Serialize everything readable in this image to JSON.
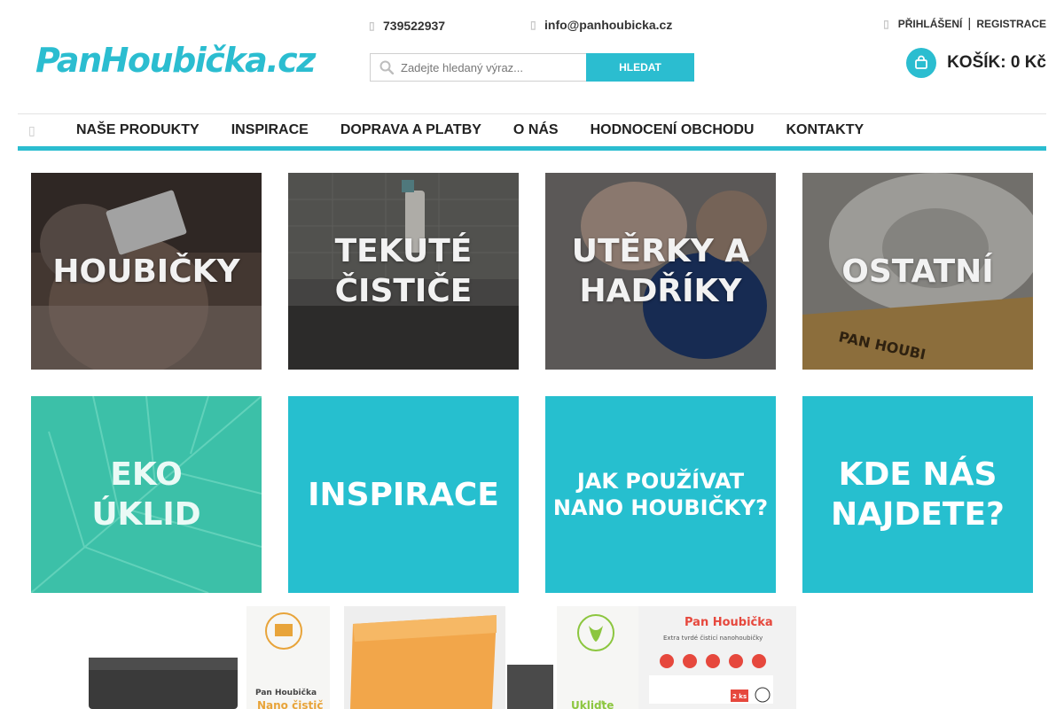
{
  "header": {
    "logo_text": "PanHoubička.cz",
    "phone": "739522937",
    "email": "info@panhoubicka.cz",
    "search_placeholder": "Zadejte hledaný výraz...",
    "search_button": "HLEDAT",
    "login": "PŘIHLÁŠENÍ",
    "separator": "|",
    "register": "REGISTRACE",
    "cart_label": "KOŠÍK:",
    "cart_total": "0 Kč"
  },
  "nav": {
    "items": [
      "NAŠE PRODUKTY",
      "INSPIRACE",
      "DOPRAVA A PLATBY",
      "O NÁS",
      "HODNOCENÍ OBCHODU",
      "KONTAKTY"
    ]
  },
  "tiles": [
    {
      "label": "HOUBIČKY"
    },
    {
      "label": "TEKUTÉ\nČISTIČE"
    },
    {
      "label": "UTĚRKY A\nHADŘÍKY"
    },
    {
      "label": "OSTATNÍ"
    },
    {
      "label": "EKO\nÚKLID"
    },
    {
      "label": "INSPIRACE"
    },
    {
      "label": "JAK POUŽÍVAT\nNANO HOUBIČKY?"
    },
    {
      "label": "KDE NÁS\nNAJDETE?"
    }
  ],
  "products": {
    "bottle1_text": "Nano čistič",
    "bottle2_text": "Ukliďte",
    "pack_brand": "Pan Houbička",
    "pack_subtitle": "Extra tvrdé čisticí nanohoubičky",
    "pack_count": "2 ks"
  },
  "colors": {
    "accent": "#2bbdd0",
    "tile_teal": "#26bfcf",
    "text_dark": "#222222"
  },
  "icons": {
    "phone": "phone-icon",
    "email": "envelope-icon",
    "user": "user-icon",
    "search": "search-icon",
    "cart": "cart-icon",
    "home": "home-icon"
  }
}
